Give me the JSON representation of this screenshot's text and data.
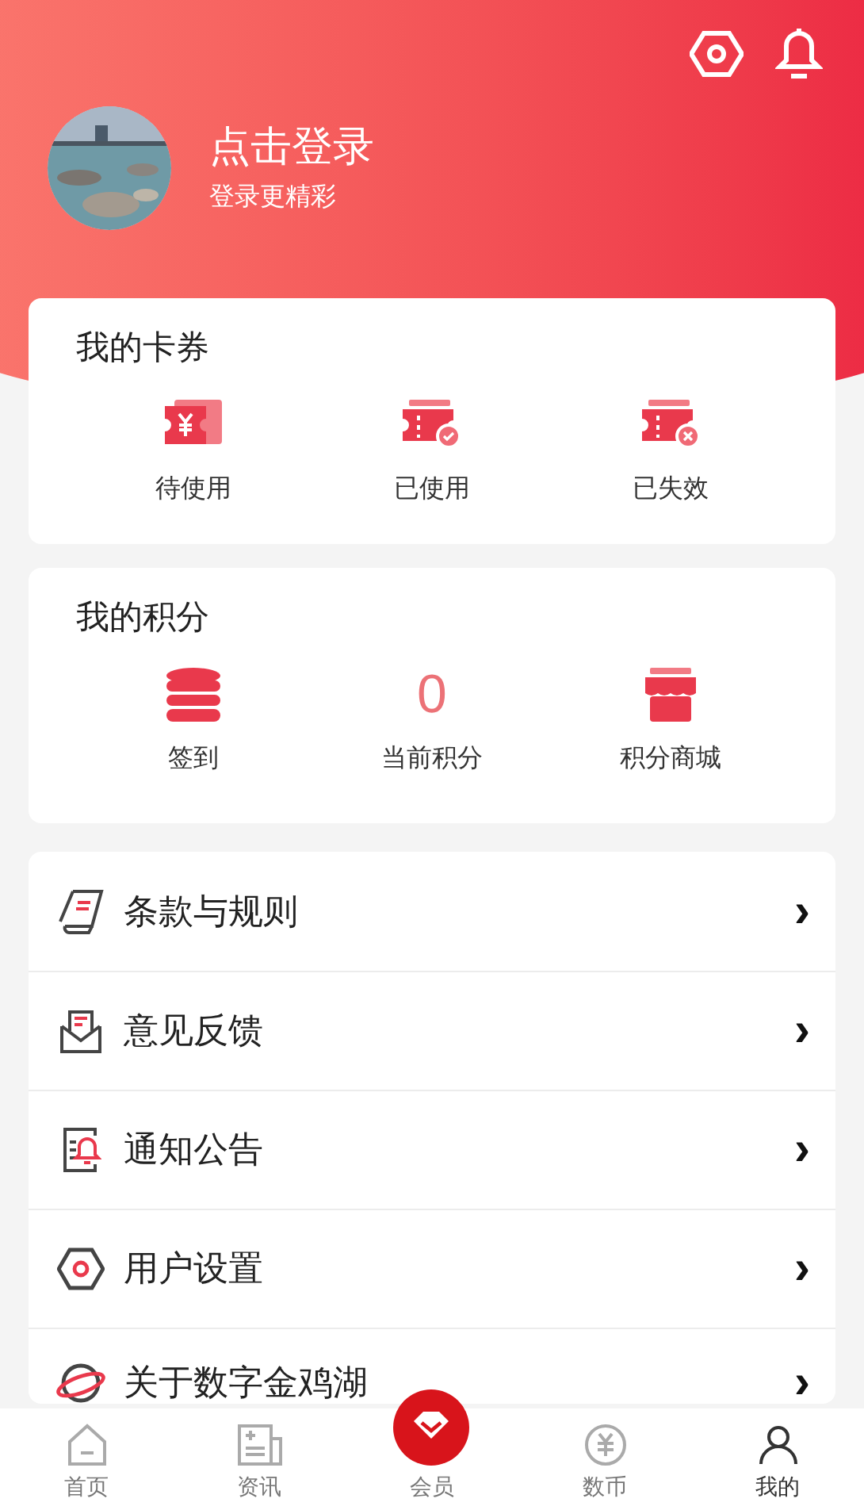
{
  "header": {
    "title": "点击登录",
    "subtitle": "登录更精彩"
  },
  "coupons": {
    "title": "我的卡券",
    "items": [
      {
        "kind": "pending",
        "label": "待使用"
      },
      {
        "kind": "used",
        "label": "已使用"
      },
      {
        "kind": "expired",
        "label": "已失效"
      }
    ]
  },
  "points": {
    "title": "我的积分",
    "items": [
      {
        "kind": "checkin",
        "label": "签到"
      },
      {
        "kind": "value",
        "value": "0",
        "label": "当前积分"
      },
      {
        "kind": "store",
        "label": "积分商城"
      }
    ]
  },
  "menu": [
    {
      "kind": "terms",
      "label": "条款与规则",
      "chevron": "›"
    },
    {
      "kind": "feedback",
      "label": "意见反馈",
      "chevron": "›"
    },
    {
      "kind": "notice",
      "label": "通知公告",
      "chevron": "›"
    },
    {
      "kind": "settings",
      "label": "用户设置",
      "chevron": "›"
    },
    {
      "kind": "about",
      "label": "关于数字金鸡湖",
      "chevron": "›"
    }
  ],
  "tab_bar": [
    {
      "kind": "home",
      "label": "首页",
      "selected": false
    },
    {
      "kind": "news",
      "label": "资讯",
      "selected": false
    },
    {
      "kind": "member",
      "label": "会员",
      "selected": false
    },
    {
      "kind": "coin",
      "label": "数币",
      "selected": false
    },
    {
      "kind": "mine",
      "label": "我的",
      "selected": true
    }
  ]
}
